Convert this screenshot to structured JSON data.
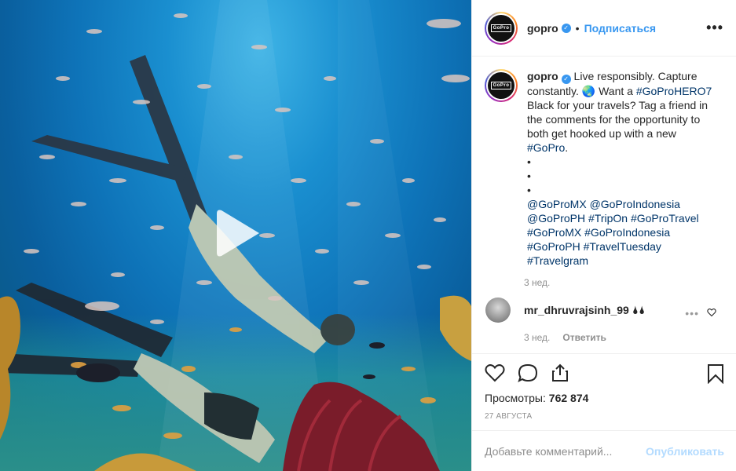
{
  "post": {
    "username": "gopro",
    "verified_icon": "verified-badge-icon",
    "separator": "•",
    "follow_label": "Подписаться",
    "more_label": "•••",
    "avatar_logo": "GoPro",
    "play_icon": "play-icon"
  },
  "caption": {
    "username": "gopro",
    "text_1": "Live responsibly. Capture constantly. 🌏 Want a ",
    "tag_hero": "#GoProHERO7",
    "text_2": " Black for your travels? Tag a friend in the comments for the opportunity to both get hooked up with a new ",
    "tag_gopro": "#GoPro",
    "text_3": ".",
    "bullets": [
      "•",
      "•",
      "•"
    ],
    "tags_line1": [
      "@GoProMX",
      "@GoProIndonesia"
    ],
    "tags_line2": [
      "@GoProPH",
      "#TripOn",
      "#GoProTravel"
    ],
    "tags_line3": [
      "#GoProMX",
      "#GoProIndonesia"
    ],
    "tags_line4": [
      "#GoProPH",
      "#TravelTuesday"
    ],
    "tags_line5": [
      "#Travelgram"
    ],
    "age": "3 нед."
  },
  "comment": {
    "username": "mr_dhruvrajsinh_99",
    "text": "🌢🌢",
    "age": "3 нед.",
    "reply_label": "Ответить",
    "dots_label": "•••"
  },
  "actions": {
    "views_label": "Просмотры:",
    "views_count": "762 874",
    "date": "27 АВГУСТА"
  },
  "add_comment": {
    "placeholder": "Добавьте комментарий...",
    "publish_label": "Опубликовать"
  },
  "colors": {
    "link": "#003569",
    "accent": "#3897f0",
    "publish_disabled": "#b3dbff",
    "muted": "#8e8e8e"
  }
}
